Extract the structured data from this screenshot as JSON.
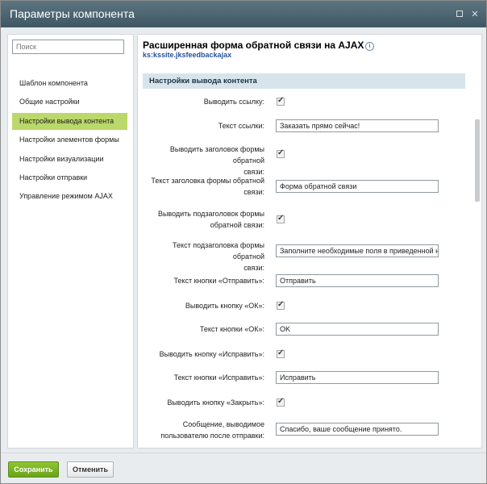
{
  "window": {
    "title": "Параметры компонента"
  },
  "sidebar": {
    "search_placeholder": "Поиск",
    "items": [
      {
        "label": "Шаблон компонента"
      },
      {
        "label": "Общие настройки"
      },
      {
        "label": "Настройки вывода контента",
        "active": true
      },
      {
        "label": "Настройки элементов формы"
      },
      {
        "label": "Настройки визуализации"
      },
      {
        "label": "Настройки отправки"
      },
      {
        "label": "Управление режимом AJAX"
      }
    ]
  },
  "main": {
    "component_title": "Расширенная форма обратной связи на AJAX",
    "component_id": "ks:kssite.jksfeedbackajax",
    "section_title": "Настройки вывода контента",
    "fields": {
      "show_link": {
        "label": "Выводить ссылку:",
        "checked": true
      },
      "link_text": {
        "label": "Текст ссылки:",
        "value": "Заказать прямо сейчас!"
      },
      "show_form_title": {
        "label1": "Выводить заголовок формы обратной",
        "label2": "связи:",
        "checked": true
      },
      "form_title_text": {
        "label1": "Текст заголовка формы обратной",
        "label2": "связи:",
        "value": "Форма обратной связи"
      },
      "show_form_subtitle": {
        "label1": "Выводить подзаголовок формы",
        "label2": "обратной связи:",
        "checked": true
      },
      "form_subtitle_text": {
        "label1": "Текст подзаголовка формы обратной",
        "label2": "связи:",
        "value": "Заполните необходимые поля в приведенной ниже ф"
      },
      "send_button_text": {
        "label": "Текст кнопки «Отправить»:",
        "value": "Отправить"
      },
      "show_ok_button": {
        "label": "Выводить кнопку «ОК»:",
        "checked": true
      },
      "ok_button_text": {
        "label": "Текст кнопки «ОК»:",
        "value": "OK"
      },
      "show_fix_button": {
        "label": "Выводить кнопку «Исправить»:",
        "checked": true
      },
      "fix_button_text": {
        "label": "Текст кнопки «Исправить»:",
        "value": "Исправить"
      },
      "show_close_button": {
        "label": "Выводить кнопку «Закрыть»:",
        "checked": true
      },
      "success_message": {
        "label1": "Сообщение, выводимое",
        "label2": "пользователю после отправки:",
        "value": "Спасибо, ваше сообщение принято."
      }
    }
  },
  "footer": {
    "save_label": "Сохранить",
    "cancel_label": "Отменить"
  },
  "colors": {
    "titlebar": "#4b6470",
    "active_nav": "#bbd86a",
    "save_button": "#7db42a",
    "section_header": "#d7e4ec",
    "link_color": "#27539c"
  }
}
